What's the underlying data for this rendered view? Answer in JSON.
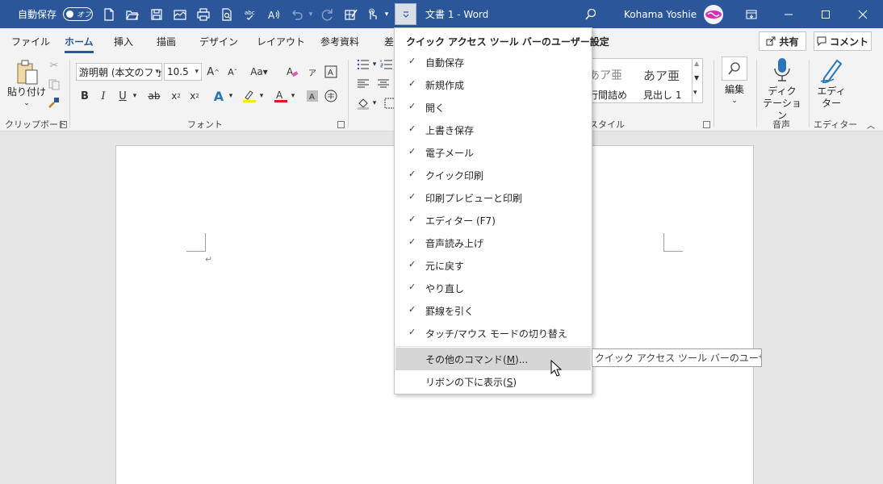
{
  "titlebar": {
    "autosave_label": "自動保存",
    "autosave_state": "オフ",
    "doc_title": "文書 1  -  Word",
    "user_name": "Kohama Yoshie",
    "qat_icons": [
      "new-document-icon",
      "open-folder-icon",
      "save-icon",
      "email-icon",
      "quick-print-icon",
      "print-preview-icon",
      "spelling-abc-icon",
      "read-aloud-icon",
      "undo-icon",
      "redo-icon",
      "draw-table-icon",
      "touch-mode-icon"
    ],
    "colors": {
      "bar": "#2b579a",
      "text": "#ffffff"
    }
  },
  "tabs": {
    "items": [
      "ファイル",
      "ホーム",
      "挿入",
      "描画",
      "デザイン",
      "レイアウト",
      "参考資料",
      "差"
    ],
    "active": "ホーム",
    "share_label": "共有",
    "comment_label": "コメント"
  },
  "ribbon": {
    "clipboard": {
      "paste_label": "貼り付け",
      "group_label": "クリップボード"
    },
    "font": {
      "font_name": "游明朝 (本文のフォ",
      "font_size": "10.5",
      "group_label": "フォント",
      "text_color": "#e81123",
      "highlight_color": "#ffe600"
    },
    "styles": {
      "style1_sample": "あア亜",
      "style1_name": "行間詰め",
      "style2_sample": "あア亜",
      "style2_name": "見出し 1",
      "group_label": "スタイル"
    },
    "editing": {
      "label": "編集"
    },
    "voice": {
      "dictate_line1": "ディク",
      "dictate_line2": "テーション",
      "group_label": "音声"
    },
    "editor": {
      "line1": "エディ",
      "line2": "ター",
      "group_label": "エディター"
    }
  },
  "qat_menu": {
    "title": "クイック アクセス ツール バーのユーザー設定",
    "items": [
      {
        "label": "自動保存",
        "checked": true
      },
      {
        "label": "新規作成",
        "checked": true
      },
      {
        "label": "開く",
        "checked": true
      },
      {
        "label": "上書き保存",
        "checked": true
      },
      {
        "label": "電子メール",
        "checked": true
      },
      {
        "label": "クイック印刷",
        "checked": true
      },
      {
        "label": "印刷プレビューと印刷",
        "checked": true
      },
      {
        "label": "エディター (F7)",
        "checked": true
      },
      {
        "label": "音声読み上げ",
        "checked": true
      },
      {
        "label": "元に戻す",
        "checked": true
      },
      {
        "label": "やり直し",
        "checked": true
      },
      {
        "label": "罫線を引く",
        "checked": true
      },
      {
        "label": "タッチ/マウス モードの切り替え",
        "checked": true
      }
    ],
    "check_glyph": "✓",
    "more_commands": {
      "prefix": "その他のコマンド(",
      "key": "M",
      "suffix": ")..."
    },
    "show_below": {
      "prefix": "リボンの下に表示(",
      "key": "S",
      "suffix": ")"
    }
  },
  "tooltip": {
    "text": "クイック アクセス ツール バーのユーザー設定"
  }
}
